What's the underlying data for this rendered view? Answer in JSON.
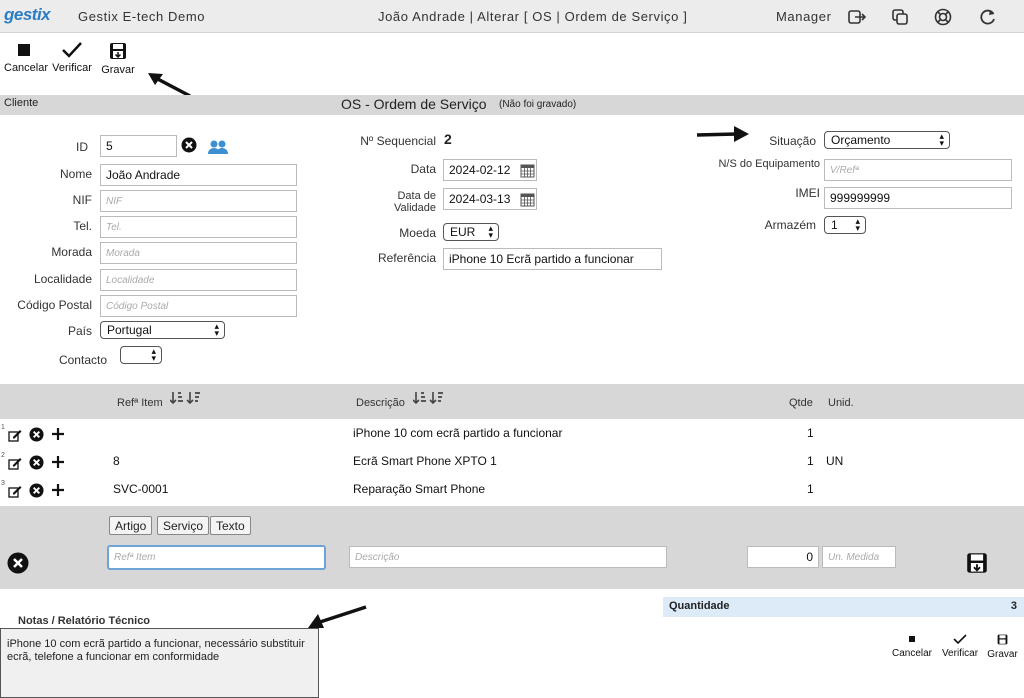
{
  "topbar": {
    "logo": "gestix",
    "app_name": "Gestix E-tech Demo",
    "heading": "João Andrade | Alterar [ OS | Ordem de Serviço ]",
    "user_role": "Manager"
  },
  "toolbar": {
    "cancel_label": "Cancelar",
    "verify_label": "Verificar",
    "save_label": "Gravar"
  },
  "section": {
    "client_label": "Cliente",
    "title": "OS - Ordem de Serviço",
    "title_note": "(Não foi gravado)"
  },
  "client": {
    "id_label": "ID",
    "id_value": "5",
    "name_label": "Nome",
    "name_value": "João Andrade",
    "nif_label": "NIF",
    "nif_placeholder": "NIF",
    "tel_label": "Tel.",
    "tel_placeholder": "Tel.",
    "address_label": "Morada",
    "address_placeholder": "Morada",
    "city_label": "Localidade",
    "city_placeholder": "Localidade",
    "postal_label": "Código Postal",
    "postal_placeholder": "Código Postal",
    "country_label": "País",
    "country_value": "Portugal",
    "contact_label": "Contacto",
    "contact_value": ""
  },
  "order": {
    "seq_label": "Nº Sequencial",
    "seq_value": "2",
    "date_label": "Data",
    "date_value": "2024-02-12",
    "validity_label_1": "Data de",
    "validity_label_2": "Validade",
    "validity_value": "2024-03-13",
    "currency_label": "Moeda",
    "currency_value": "EUR",
    "ref_label": "Referência",
    "ref_value": "iPhone 10 Ecrã partido a funcionar"
  },
  "status": {
    "situation_label": "Situação",
    "situation_value": "Orçamento",
    "serial_label": "N/S do Equipamento",
    "serial_placeholder": "V/Refª",
    "imei_label": "IMEI",
    "imei_value": "999999999",
    "warehouse_label": "Armazém",
    "warehouse_value": "1"
  },
  "items_table": {
    "headers": {
      "ref": "Refª Item",
      "desc": "Descrição",
      "qty": "Qtde",
      "unit": "Unid."
    },
    "rows": [
      {
        "num": "1",
        "ref": "",
        "desc": "iPhone 10 com ecrã partido a funcionar",
        "qty": "1",
        "unit": ""
      },
      {
        "num": "2",
        "ref": "8",
        "desc": "Ecrã Smart Phone XPTO 1",
        "qty": "1",
        "unit": "UN"
      },
      {
        "num": "3",
        "ref": "SVC-0001",
        "desc": "Reparação Smart Phone",
        "qty": "1",
        "unit": ""
      }
    ]
  },
  "new_item": {
    "type_article": "Artigo",
    "type_service": "Serviço",
    "type_text": "Texto",
    "ref_placeholder": "Refª Item",
    "desc_placeholder": "Descrição",
    "qty_value": "0",
    "unit_placeholder": "Un. Medida"
  },
  "notes": {
    "title": "Notas / Relatório Técnico",
    "text": "iPhone 10 com ecrã partido a funcionar, necessário substituir ecrã, telefone a funcionar em conformidade"
  },
  "totals": {
    "qty_label": "Quantidade",
    "qty_value": "3"
  },
  "colors": {
    "brand": "#2a7dc2",
    "bar": "#d7d7d7",
    "totals_bg": "#dcebf7",
    "focus": "#6fa3d8"
  }
}
